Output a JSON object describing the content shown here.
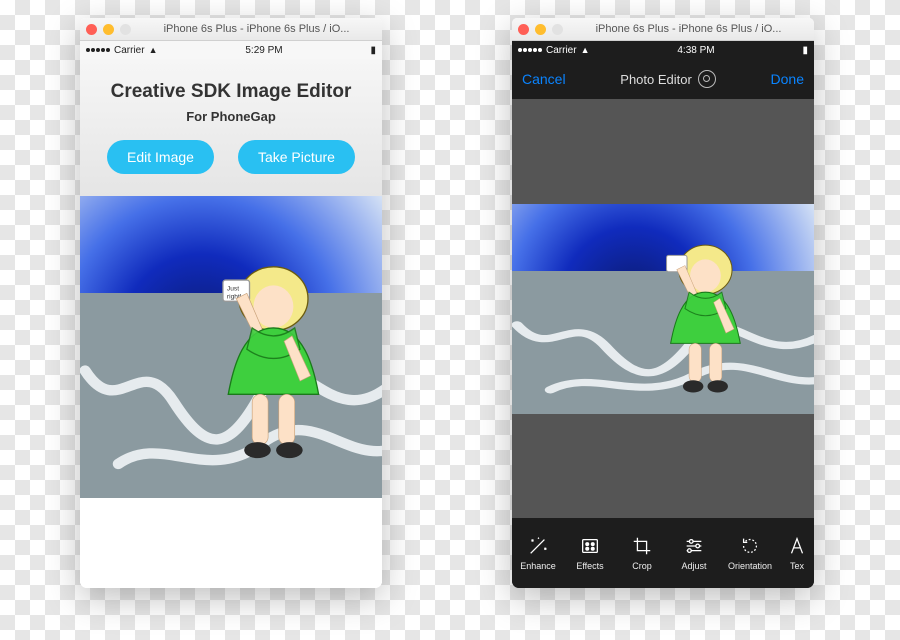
{
  "mac_title": "iPhone 6s Plus - iPhone 6s Plus / iO...",
  "left": {
    "status": {
      "carrier": "Carrier",
      "time": "5:29 PM"
    },
    "heading": "Creative SDK Image Editor",
    "subheading": "For PhoneGap",
    "edit_btn": "Edit Image",
    "take_btn": "Take Picture"
  },
  "right": {
    "status": {
      "carrier": "Carrier",
      "time": "4:38 PM"
    },
    "nav": {
      "cancel": "Cancel",
      "title": "Photo Editor",
      "done": "Done"
    },
    "tools": {
      "enhance": "Enhance",
      "effects": "Effects",
      "crop": "Crop",
      "adjust": "Adjust",
      "orientation": "Orientation",
      "text": "Tex"
    }
  },
  "image_note": {
    "just": "Just",
    "right": "right!"
  }
}
